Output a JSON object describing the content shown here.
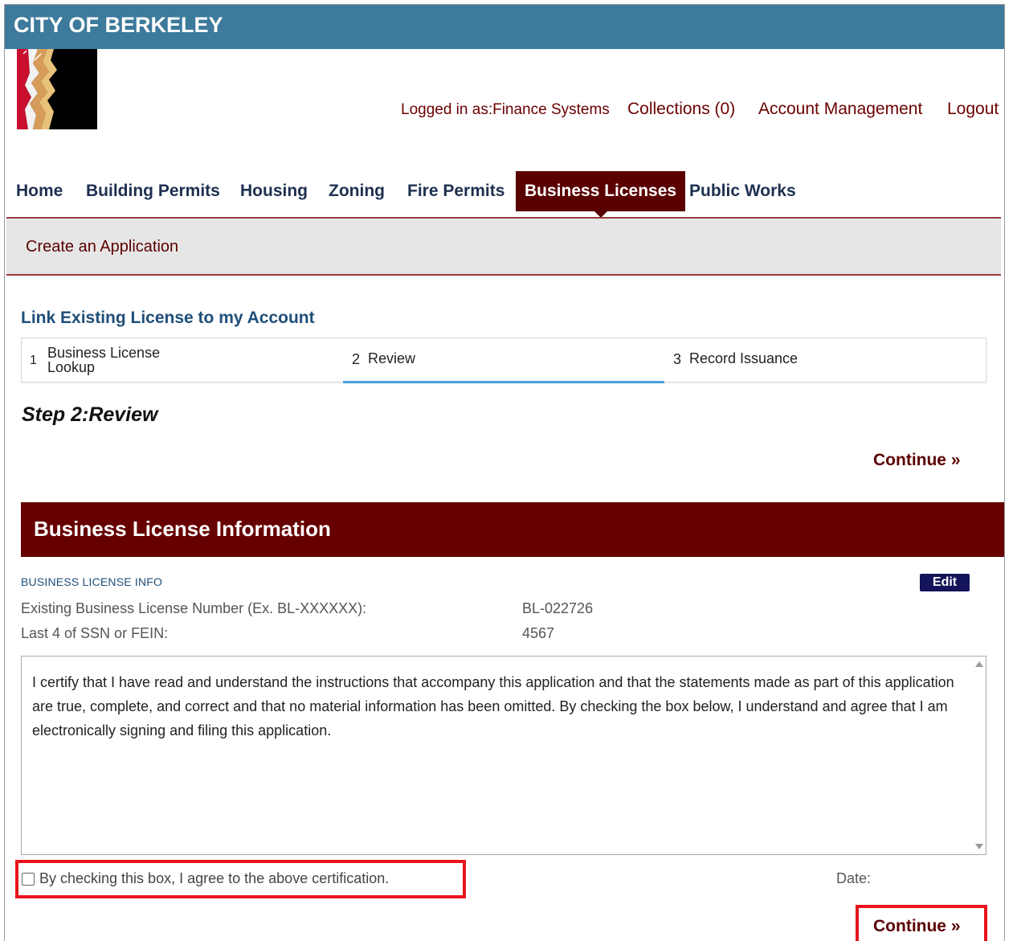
{
  "header": {
    "title": "CITY OF BERKELEY"
  },
  "user_nav": {
    "logged_in": "Logged in as:Finance Systems",
    "collections": "Collections (0)",
    "account_management": "Account Management",
    "logout": "Logout"
  },
  "main_nav": {
    "items": [
      "Home",
      "Building Permits",
      "Housing",
      "Zoning",
      "Fire Permits",
      "Business Licenses",
      "Public Works"
    ],
    "active": "Business Licenses"
  },
  "sub_nav": {
    "title": "Create an Application"
  },
  "page": {
    "link_title": "Link Existing License to my Account",
    "steps": [
      {
        "num": "1",
        "label": "Business License Lookup"
      },
      {
        "num": "2",
        "label": "Review"
      },
      {
        "num": "3",
        "label": "Record Issuance"
      }
    ],
    "active_step": "2",
    "step_heading": "Step 2:Review",
    "continue_label": "Continue »"
  },
  "section": {
    "title": "Business License Information",
    "info_label": "BUSINESS LICENSE INFO",
    "edit_label": "Edit",
    "fields": [
      {
        "label": "Existing Business License Number (Ex. BL-XXXXXX):",
        "value": "BL-022726"
      },
      {
        "label": "Last 4 of SSN or FEIN:",
        "value": "4567"
      }
    ]
  },
  "certification": {
    "text": "I certify that I have read and understand the instructions that accompany this application and that the statements made as part of this application are true, complete, and correct and that no material information has been omitted. By checking the box below, I understand and agree that I am electronically signing and filing this application.",
    "agree_label": "By checking this box, I agree to the above certification.",
    "agree_checked": false,
    "date_label": "Date:"
  },
  "colors": {
    "header_bg": "#3d7a9b",
    "accent_maroon": "#660000",
    "highlight_red": "#e8141c",
    "link_blue": "#1f4e79",
    "active_step_underline": "#4aa3df"
  },
  "icons": [
    "berkeley-logo",
    "scroll-up-arrow",
    "scroll-down-arrow",
    "checkbox"
  ]
}
